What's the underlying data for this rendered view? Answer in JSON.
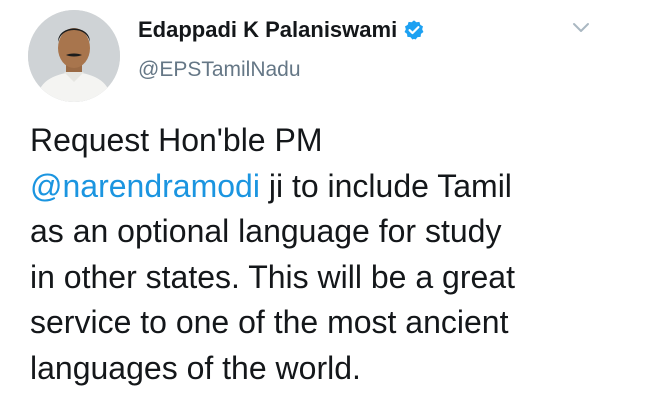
{
  "author": {
    "display_name": "Edappadi K Palaniswami",
    "handle": "@EPSTamilNadu",
    "verified": true,
    "avatar_icon": "profile-photo",
    "verified_icon": "verified-badge-icon"
  },
  "menu": {
    "icon": "chevron-down-icon"
  },
  "tweet": {
    "line1": "Request Hon'ble PM",
    "mention": "@narendramodi",
    "line2_rest": " ji to include Tamil",
    "line3": "as an optional language for study",
    "line4": "in other states. This will be a great",
    "line5": "service to one of the most ancient",
    "line6": "languages of the world."
  },
  "colors": {
    "mention": "#1b95e0",
    "verified": "#1da1f2",
    "handle": "#657786",
    "text": "#14171a"
  }
}
